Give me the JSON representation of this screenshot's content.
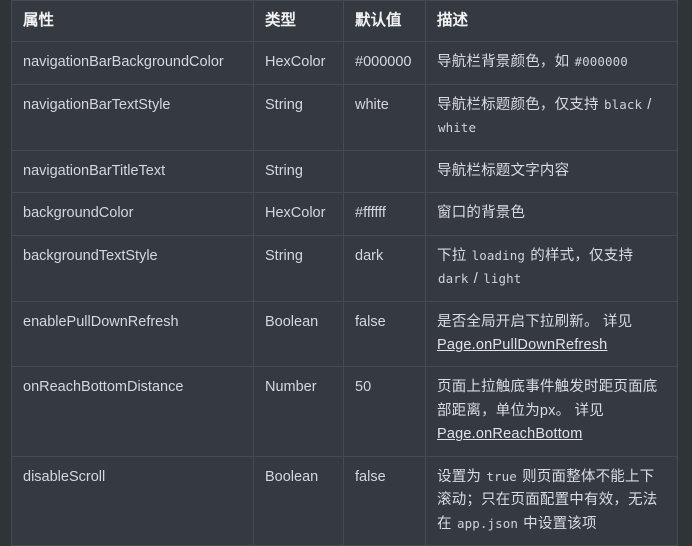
{
  "table": {
    "headers": [
      "属性",
      "类型",
      "默认值",
      "描述"
    ],
    "rows": [
      {
        "attr": "navigationBarBackgroundColor",
        "type": "HexColor",
        "default": "#000000",
        "desc_parts": [
          {
            "kind": "text",
            "text": "导航栏背景颜色，如 "
          },
          {
            "kind": "code",
            "text": "#000000"
          }
        ]
      },
      {
        "attr": "navigationBarTextStyle",
        "type": "String",
        "default": "white",
        "desc_parts": [
          {
            "kind": "text",
            "text": "导航栏标题颜色，仅支持 "
          },
          {
            "kind": "code",
            "text": "black"
          },
          {
            "kind": "text",
            "text": " / "
          },
          {
            "kind": "code",
            "text": "white"
          }
        ]
      },
      {
        "attr": "navigationBarTitleText",
        "type": "String",
        "default": "",
        "desc_parts": [
          {
            "kind": "text",
            "text": "导航栏标题文字内容"
          }
        ]
      },
      {
        "attr": "backgroundColor",
        "type": "HexColor",
        "default": "#ffffff",
        "desc_parts": [
          {
            "kind": "text",
            "text": "窗口的背景色"
          }
        ]
      },
      {
        "attr": "backgroundTextStyle",
        "type": "String",
        "default": "dark",
        "desc_parts": [
          {
            "kind": "text",
            "text": "下拉 "
          },
          {
            "kind": "code",
            "text": "loading"
          },
          {
            "kind": "text",
            "text": " 的样式，仅支持 "
          },
          {
            "kind": "code",
            "text": "dark"
          },
          {
            "kind": "text",
            "text": " / "
          },
          {
            "kind": "code",
            "text": "light"
          }
        ]
      },
      {
        "attr": "enablePullDownRefresh",
        "type": "Boolean",
        "default": "false",
        "desc_parts": [
          {
            "kind": "text",
            "text": "是否全局开启下拉刷新。 详见 "
          },
          {
            "kind": "link",
            "text": "Page.onPullDownRefresh"
          }
        ]
      },
      {
        "attr": "onReachBottomDistance",
        "type": "Number",
        "default": "50",
        "desc_parts": [
          {
            "kind": "text",
            "text": "页面上拉触底事件触发时距页面底部距离，单位为px。 详见 "
          },
          {
            "kind": "link",
            "text": "Page.onReachBottom"
          }
        ]
      },
      {
        "attr": "disableScroll",
        "type": "Boolean",
        "default": "false",
        "desc_parts": [
          {
            "kind": "text",
            "text": "设置为 "
          },
          {
            "kind": "code",
            "text": "true"
          },
          {
            "kind": "text",
            "text": " 则页面整体不能上下滚动；只在页面配置中有效，无法在 "
          },
          {
            "kind": "code",
            "text": "app.json"
          },
          {
            "kind": "text",
            "text": " 中设置该项"
          }
        ]
      }
    ]
  },
  "theme": {
    "page_background": "#2f3439",
    "cell_background": "#343a40",
    "border_color": "#454b51",
    "text_color": "#d7dade",
    "header_text_color": "#f0f2f4",
    "code_text_color": "#cfd3d7",
    "link_color": "#dfe2e6"
  }
}
